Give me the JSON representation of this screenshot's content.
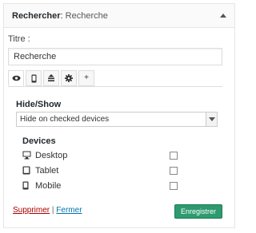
{
  "widget": {
    "title_bold": "Rechercher",
    "title_sep": ": ",
    "title_name": "Recherche"
  },
  "form": {
    "title_label": "Titre :",
    "title_value": "Recherche"
  },
  "tabs": [
    {
      "icon": "eye-icon",
      "active": true
    },
    {
      "icon": "mobile-icon",
      "active": false
    },
    {
      "icon": "align-icon",
      "active": false
    },
    {
      "icon": "gear-icon",
      "active": false
    },
    {
      "label": "+",
      "active": false
    }
  ],
  "hide_show": {
    "label": "Hide/Show",
    "selected": "Hide on checked devices"
  },
  "devices": {
    "label": "Devices",
    "items": [
      {
        "name": "Desktop",
        "checked": false
      },
      {
        "name": "Tablet",
        "checked": false
      },
      {
        "name": "Mobile",
        "checked": false
      }
    ]
  },
  "actions": {
    "delete": "Supprimer",
    "separator": " | ",
    "close": "Fermer",
    "save": "Enregistrer"
  },
  "colors": {
    "save_button": "#2e9a6f",
    "delete_link": "#aa0000",
    "close_link": "#0073aa"
  }
}
